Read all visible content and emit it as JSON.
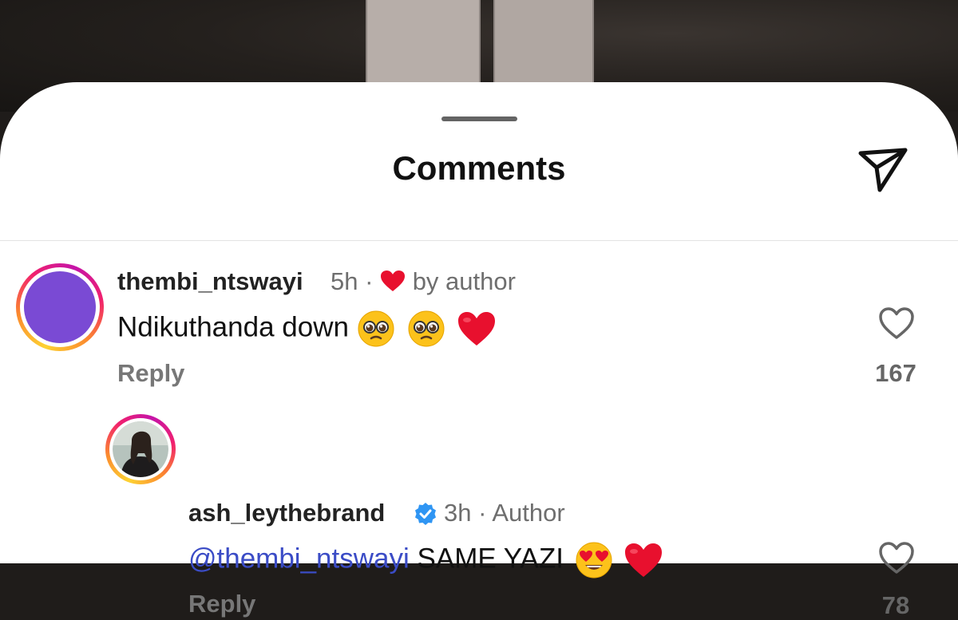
{
  "header": {
    "title": "Comments",
    "share_icon": "send-icon"
  },
  "comments": [
    {
      "username": "thembi_ntswayi",
      "time": "5h",
      "separator": "·",
      "liked_by_author": "by author",
      "text": "Ndikuthanda down",
      "emojis": [
        "pleading-face",
        "pleading-face",
        "red-heart"
      ],
      "reply_label": "Reply",
      "like_count": "167",
      "avatar_color": "#7a4ad4"
    },
    {
      "username": "ash_leythebrand",
      "verified": true,
      "time": "3h",
      "separator": "·",
      "author_badge": "Author",
      "mention": "@thembi_ntswayi",
      "text": "SAME YAZI",
      "emojis": [
        "heart-eyes-face",
        "red-heart"
      ],
      "reply_label": "Reply",
      "like_count": "78"
    }
  ],
  "colors": {
    "mention": "#3b4cc6",
    "heart": "#e8102e",
    "verified": "#2f95f3"
  }
}
